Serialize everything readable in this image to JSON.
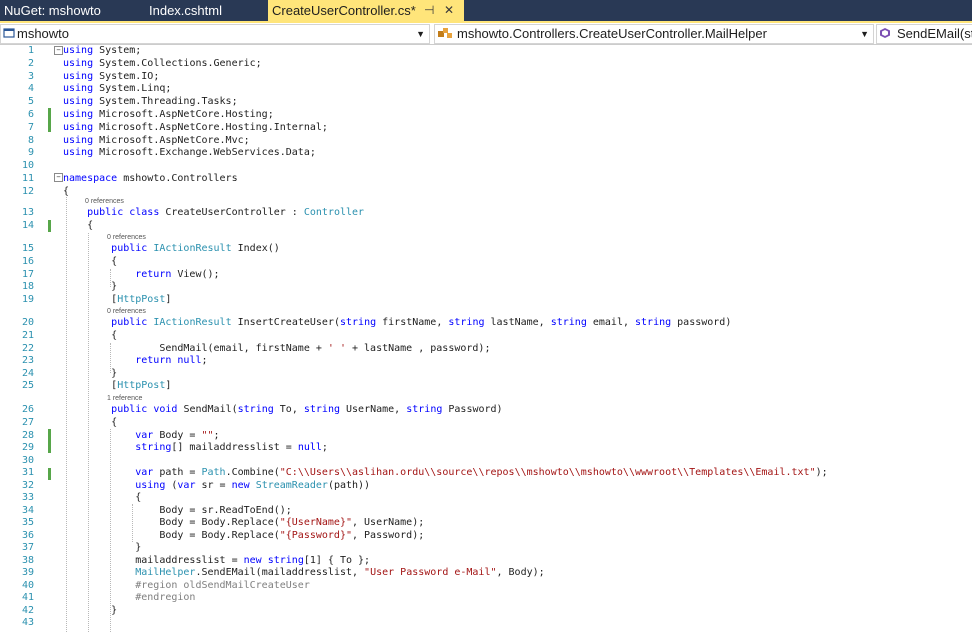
{
  "tabs": [
    {
      "label": "NuGet: mshowto",
      "active": false
    },
    {
      "label": "Index.cshtml",
      "active": false
    },
    {
      "label": "CreateUserController.cs*",
      "active": true
    }
  ],
  "tab_controls": {
    "pin": "⊣",
    "close": "✕"
  },
  "navbar": {
    "project": "mshowto",
    "class_path": "mshowto.Controllers.CreateUserController.MailHelper",
    "member": "SendEMail(st"
  },
  "codelens": {
    "zero_refs": "0 references",
    "one_ref": "1 reference"
  },
  "code_lines": [
    {
      "n": "1",
      "text": "using System;"
    },
    {
      "n": "2",
      "text": "using System.Collections.Generic;"
    },
    {
      "n": "3",
      "text": "using System.IO;"
    },
    {
      "n": "4",
      "text": "using System.Linq;"
    },
    {
      "n": "5",
      "text": "using System.Threading.Tasks;"
    },
    {
      "n": "6",
      "text": "using Microsoft.AspNetCore.Hosting;"
    },
    {
      "n": "7",
      "text": "using Microsoft.AspNetCore.Hosting.Internal;"
    },
    {
      "n": "8",
      "text": "using Microsoft.AspNetCore.Mvc;"
    },
    {
      "n": "9",
      "text": "using Microsoft.Exchange.WebServices.Data;"
    },
    {
      "n": "10",
      "text": ""
    },
    {
      "n": "11",
      "text": "namespace mshowto.Controllers"
    },
    {
      "n": "12",
      "text": "{"
    },
    {
      "n": "13",
      "text": "    public class CreateUserController : Controller"
    },
    {
      "n": "14",
      "text": "    {"
    },
    {
      "n": "15",
      "text": "        public IActionResult Index()"
    },
    {
      "n": "16",
      "text": "        {"
    },
    {
      "n": "17",
      "text": "            return View();"
    },
    {
      "n": "18",
      "text": "        }"
    },
    {
      "n": "19",
      "text": "        [HttpPost]"
    },
    {
      "n": "20",
      "text": "        public IActionResult InsertCreateUser(string firstName, string lastName, string email, string password)"
    },
    {
      "n": "21",
      "text": "        {"
    },
    {
      "n": "22",
      "text": "                SendMail(email, firstName + ' ' + lastName , password);"
    },
    {
      "n": "23",
      "text": "            return null;"
    },
    {
      "n": "24",
      "text": "        }"
    },
    {
      "n": "25",
      "text": "        [HttpPost]"
    },
    {
      "n": "26",
      "text": "        public void SendMail(string To, string UserName, string Password)"
    },
    {
      "n": "27",
      "text": "        {"
    },
    {
      "n": "28",
      "text": "            var Body = \"\";"
    },
    {
      "n": "29",
      "text": "            string[] mailaddresslist = null;"
    },
    {
      "n": "30",
      "text": ""
    },
    {
      "n": "31",
      "text": "            var path = Path.Combine(\"C:\\\\Users\\\\aslihan.ordu\\\\source\\\\repos\\\\mshowto\\\\mshowto\\\\wwwroot\\\\Templates\\\\Email.txt\");"
    },
    {
      "n": "32",
      "text": "            using (var sr = new StreamReader(path))"
    },
    {
      "n": "33",
      "text": "            {"
    },
    {
      "n": "34",
      "text": "                Body = sr.ReadToEnd();"
    },
    {
      "n": "35",
      "text": "                Body = Body.Replace(\"{UserName}\", UserName);"
    },
    {
      "n": "36",
      "text": "                Body = Body.Replace(\"{Password}\", Password);"
    },
    {
      "n": "37",
      "text": "            }"
    },
    {
      "n": "38",
      "text": "            mailaddresslist = new string[1] { To };"
    },
    {
      "n": "39",
      "text": "            MailHelper.SendEMail(mailaddresslist, \"User Password e-Mail\", Body);"
    },
    {
      "n": "40",
      "text": "            #region oldSendMailCreateUser"
    },
    {
      "n": "41",
      "text": "            #endregion"
    },
    {
      "n": "42",
      "text": "        }"
    },
    {
      "n": "43",
      "text": ""
    }
  ],
  "colors": {
    "keyword": "#0000ff",
    "type": "#2b91af",
    "string": "#a31515",
    "line_number": "#2b91af",
    "change_bar": "#57a64a",
    "tab_strip": "#293955",
    "active_tab": "#ffe57a"
  }
}
